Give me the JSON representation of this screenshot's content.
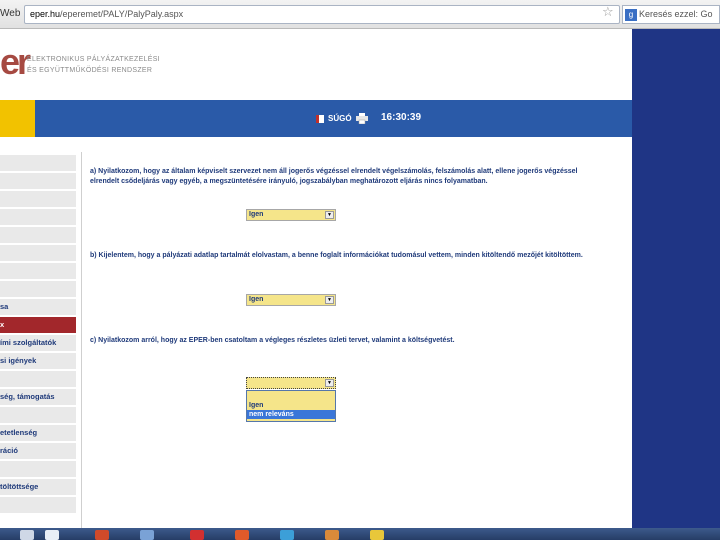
{
  "browser": {
    "tab_fragment": "Web",
    "url_domain": "eper.hu",
    "url_path": "/eperemet/PALY/PalyPaly.aspx",
    "search_placeholder": "Keresés ezzel: Go"
  },
  "header": {
    "logo_mark": "er",
    "title_line1": "ELEKTRONIKUS PÁLYÁZATKEZELÉSI",
    "title_line2": "ÉS EGYÜTTMŰKÖDÉSI RENDSZER"
  },
  "band": {
    "help_label": "SÚGÓ",
    "time": "16:30:39"
  },
  "sidebar": {
    "items": [
      {
        "label": ""
      },
      {
        "label": ""
      },
      {
        "label": ""
      },
      {
        "label": ""
      },
      {
        "label": ""
      },
      {
        "label": ""
      },
      {
        "label": ""
      },
      {
        "label": ""
      },
      {
        "label": "sa"
      },
      {
        "label": "x",
        "active": true
      },
      {
        "label": "ími szolgáltatók"
      },
      {
        "label": "si igények"
      },
      {
        "label": ""
      },
      {
        "label": "ség, támogatás"
      },
      {
        "label": ""
      },
      {
        "label": "etetlenség"
      },
      {
        "label": "ráció"
      },
      {
        "label": ""
      },
      {
        "label": "töltöttsége"
      },
      {
        "label": ""
      }
    ]
  },
  "main": {
    "q_a": "a) Nyilatkozom, hogy az általam képviselt szervezet nem áll jogerős végzéssel elrendelt végelszámolás, felszámolás alatt, ellene jogerős végzéssel elrendelt csődeljárás vagy egyéb, a megszüntetésére irányuló, jogszabályban meghatározott eljárás nincs folyamatban.",
    "q_a_value": "Igen",
    "q_b": "b) Kijelentem, hogy a pályázati adatlap tartalmát elolvastam, a benne foglalt információkat tudomásul vettem, minden kitöltendő mezőjét kitöltöttem.",
    "q_b_value": "Igen",
    "q_c": "c) Nyilatkozom arról, hogy az EPER-ben csatoltam a végleges részletes üzleti tervet, valamint a költségvetést.",
    "q_c_value": "",
    "q_c_options": [
      "",
      "Igen",
      "nem releváns"
    ]
  },
  "colors": {
    "brand_blue": "#2a5aa8",
    "dark_blue": "#1f3585",
    "accent_yellow": "#f2c200",
    "active_red": "#a2272b",
    "select_yellow": "#f5e58a"
  }
}
